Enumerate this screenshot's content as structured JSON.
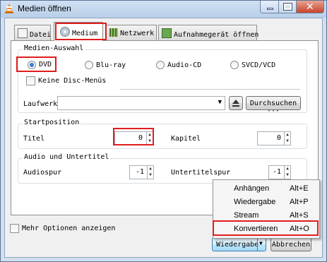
{
  "window": {
    "title": "Medien öffnen"
  },
  "tabs": [
    {
      "label": "Datei"
    },
    {
      "label": "Medium"
    },
    {
      "label": "Netzwerk"
    },
    {
      "label": "Aufnahmegerät öffnen"
    }
  ],
  "disc_selection": {
    "title": "Medien-Auswahl",
    "options": [
      "DVD",
      "Blu-ray",
      "Audio-CD",
      "SVCD/VCD"
    ],
    "selected": "DVD",
    "no_menus_label": "Keine Disc-Menüs",
    "device_label": "Laufwerk",
    "device_value": "",
    "browse_label": "Durchsuchen ···"
  },
  "start_position": {
    "title": "Startposition",
    "title_label": "Titel",
    "title_value": "0",
    "chapter_label": "Kapitel",
    "chapter_value": "0"
  },
  "audio_subtitles": {
    "title": "Audio und Untertitel",
    "audio_label": "Audiospur",
    "audio_value": "-1",
    "subtitle_label": "Untertitelspur",
    "subtitle_value": "-1"
  },
  "footer": {
    "more_options_label": "Mehr Optionen anzeigen",
    "play_label": "Wiedergabe",
    "cancel_label": "Abbrechen"
  },
  "play_menu": {
    "items": [
      {
        "label": "Anhängen",
        "shortcut": "Alt+E"
      },
      {
        "label": "Wiedergabe",
        "shortcut": "Alt+P"
      },
      {
        "label": "Stream",
        "shortcut": "Alt+S"
      },
      {
        "label": "Konvertieren",
        "shortcut": "Alt+O"
      }
    ]
  },
  "colors": {
    "highlight": "#e11d1d",
    "accent": "#1d5fb0"
  }
}
